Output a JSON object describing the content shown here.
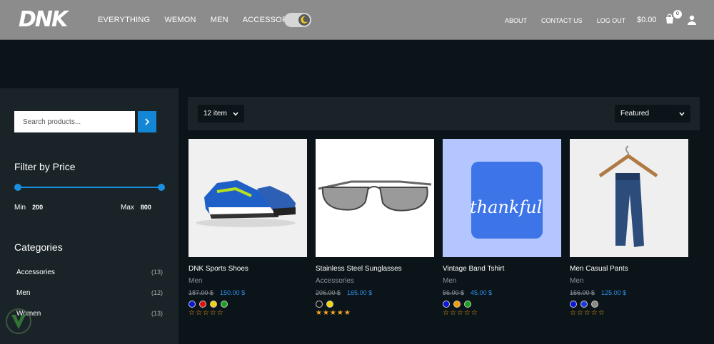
{
  "header": {
    "logo": "DNK",
    "nav": [
      "EVERYTHING",
      "WEMON",
      "MEN",
      "ACCESSORIES"
    ],
    "right_nav": [
      "ABOUT",
      "CONTACT US",
      "LOG OUT"
    ],
    "cart_total": "$0.00",
    "cart_count": "0"
  },
  "sidebar": {
    "search_placeholder": "Search products...",
    "filter_title": "Filter by Price",
    "min_label": "Min",
    "min_value": "200",
    "max_label": "Max",
    "max_value": "800",
    "categories_title": "Categories",
    "categories": [
      {
        "label": "Accessories",
        "count": "(13)"
      },
      {
        "label": "Men",
        "count": "(12)"
      },
      {
        "label": "Women",
        "count": "(13)"
      }
    ]
  },
  "toolbar": {
    "per_page": "12 item",
    "sort": "Featured"
  },
  "products": [
    {
      "name": "DNK Sports Shoes",
      "category": "Men",
      "old_price": "187.00 $",
      "price": "150.00 $",
      "colors": [
        "#0a16d8",
        "#e01010",
        "#f3d400",
        "#17a21f"
      ],
      "rating": "☆☆☆☆☆"
    },
    {
      "name": "Stainless Steel Sunglasses",
      "category": "Accessories",
      "old_price": "206.00 $",
      "price": "165.00 $",
      "colors": [
        "#111111",
        "#f3d400"
      ],
      "rating": "★★★★★"
    },
    {
      "name": "Vintage Band Tshirt",
      "category": "Men",
      "old_price": "56.00 $",
      "price": "45.00 $",
      "colors": [
        "#0a16d8",
        "#f39c00",
        "#17a21f"
      ],
      "rating": "☆☆☆☆☆"
    },
    {
      "name": "Men Casual Pants",
      "category": "Men",
      "old_price": "156.00 $",
      "price": "125.00 $",
      "colors": [
        "#0a16d8",
        "#1a3ae0",
        "#888888"
      ],
      "rating": "☆☆☆☆☆"
    }
  ],
  "tshirt_text": "thankful",
  "icons": {
    "theme_toggle": "moon-icon",
    "cart": "cart-icon",
    "user": "user-icon",
    "search": "chevron-right-icon"
  },
  "colors": {
    "accent": "#1386d6",
    "price": "#2e8ff0",
    "star": "#f5a623"
  }
}
